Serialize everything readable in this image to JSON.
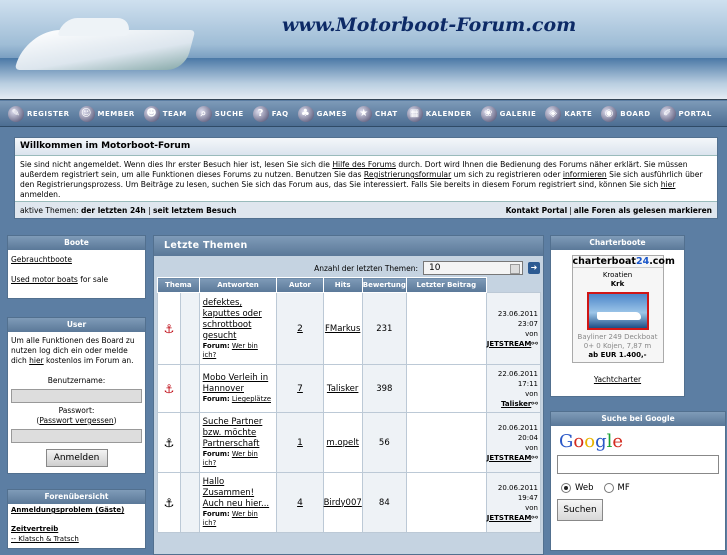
{
  "header": {
    "site_title": "www.Motorboot-Forum.com"
  },
  "nav": {
    "items": [
      {
        "label": "REGISTER",
        "icon": "register-icon",
        "glyph": "✎"
      },
      {
        "label": "MEMBER",
        "icon": "member-icon",
        "glyph": "☺"
      },
      {
        "label": "TEAM",
        "icon": "team-icon",
        "glyph": "☻"
      },
      {
        "label": "SUCHE",
        "icon": "search-icon",
        "glyph": "⌕"
      },
      {
        "label": "FAQ",
        "icon": "faq-icon",
        "glyph": "?"
      },
      {
        "label": "GAMES",
        "icon": "games-icon",
        "glyph": "♣"
      },
      {
        "label": "CHAT",
        "icon": "chat-icon",
        "glyph": "★"
      },
      {
        "label": "KALENDER",
        "icon": "calendar-icon",
        "glyph": "▦"
      },
      {
        "label": "GALERIE",
        "icon": "gallery-icon",
        "glyph": "❀"
      },
      {
        "label": "KARTE",
        "icon": "map-icon",
        "glyph": "◈"
      },
      {
        "label": "BOARD",
        "icon": "board-icon",
        "glyph": "◉"
      },
      {
        "label": "PORTAL",
        "icon": "portal-icon",
        "glyph": "✐"
      }
    ]
  },
  "welcome": {
    "title": "Willkommen im Motorboot-Forum",
    "text1": "Sie sind nicht angemeldet. Wenn dies Ihr erster Besuch hier ist, lesen Sie sich die ",
    "link1": "Hilfe des Forums",
    "text2": " durch. Dort wird Ihnen die Bedienung des Forums näher erklärt. Sie müssen außerdem registriert sein, um alle Funktionen dieses Forums zu nutzen. Benutzen Sie das ",
    "link2": "Registrierungsformular",
    "text3": " um sich zu registrieren oder ",
    "link3": "informieren",
    "text4": " Sie sich ausführlich über den Registrierungsprozess. Um Beiträge zu lesen, suchen Sie sich das Forum aus, das Sie interessiert. Falls Sie bereits in diesem Forum registriert sind, können Sie sich ",
    "link4": "hier",
    "text5": " anmelden.",
    "bar_label": "aktive Themen:",
    "bar_link1": "der letzten 24h",
    "bar_sep": "|",
    "bar_link2": "seit letztem Besuch",
    "bar_right1": "Kontakt Portal",
    "bar_right2": "alle Foren als gelesen markieren"
  },
  "boote": {
    "title": "Boote",
    "link1": "Gebrauchtboote",
    "link2": "Used motor boats",
    "link2_suffix": " for sale"
  },
  "user": {
    "title": "User",
    "text1": "Um alle Funktionen des Board zu nutzen log dich ein oder melde dich ",
    "here": "hier",
    "text2": " kostenlos im Forum an.",
    "username_label": "Benutzername:",
    "password_label": "Passwort:",
    "forgot_prefix": "(",
    "forgot": "Passwort vergessen",
    "forgot_suffix": ")",
    "login_button": "Anmelden"
  },
  "foren": {
    "title": "Forenübersicht",
    "item1": "Anmeldungsproblem (Gäste)",
    "item2": "Zeitvertreib",
    "item3": "-- Klatsch & Tratsch"
  },
  "center": {
    "title": "Letzte Themen",
    "count_label": "Anzahl der letzten Themen:",
    "count_value": "10",
    "go_icon": "arrow-right-icon",
    "columns": [
      "Thema",
      "Antworten",
      "Autor",
      "Hits",
      "Bewertung",
      "Letzter Beitrag"
    ],
    "topics": [
      {
        "icon": "anchor-red",
        "title": "defektes, kaputtes oder schrottboot gesucht",
        "forum_label": "Forum:",
        "forum": "Wer bin ich?",
        "replies": "2",
        "author": "FMarkus",
        "hits": "231",
        "rating": "",
        "date": "23.06.2011 23:07",
        "by": "von",
        "last_user": "JETSTREAM"
      },
      {
        "icon": "anchor-red",
        "title": "Mobo Verleih in Hannover",
        "forum_label": "Forum:",
        "forum": "Liegeplätze",
        "replies": "7",
        "author": "Talisker",
        "hits": "398",
        "rating": "",
        "date": "22.06.2011 17:11",
        "by": "von",
        "last_user": "Talisker"
      },
      {
        "icon": "anchor-black",
        "title": "Suche Partner bzw. möchte Partnerschaft",
        "forum_label": "Forum:",
        "forum": "Wer bin ich?",
        "replies": "1",
        "author": "m.opelt",
        "hits": "56",
        "rating": "",
        "date": "20.06.2011 20:04",
        "by": "von",
        "last_user": "JETSTREAM"
      },
      {
        "icon": "anchor-black",
        "title": "Hallo Zusammen! Auch neu hier...",
        "forum_label": "Forum:",
        "forum": "Wer bin ich?",
        "replies": "4",
        "author": "Birdy007",
        "hits": "84",
        "rating": "",
        "date": "20.06.2011 19:47",
        "by": "von",
        "last_user": "JETSTREAM"
      }
    ]
  },
  "charter": {
    "title": "Charterboote",
    "logo_a": "charterboat",
    "logo_b": "24",
    "logo_c": ".com",
    "country": "Kroatien",
    "city": "Krk",
    "boat": "Bayliner 249 Deckboat",
    "specs": "0+ 0 Kojen, 7,87 m",
    "price": "ab EUR 1.400,-",
    "link": "Yachtcharter"
  },
  "google": {
    "title": "Suche bei Google",
    "logo": [
      "G",
      "o",
      "o",
      "g",
      "l",
      "e"
    ],
    "option1": "Web",
    "option2": "MF",
    "button": "Suchen"
  },
  "colors": {
    "accent": "#5a7898",
    "background": "#5c7ea3",
    "anchor_red": "#c0101a"
  }
}
